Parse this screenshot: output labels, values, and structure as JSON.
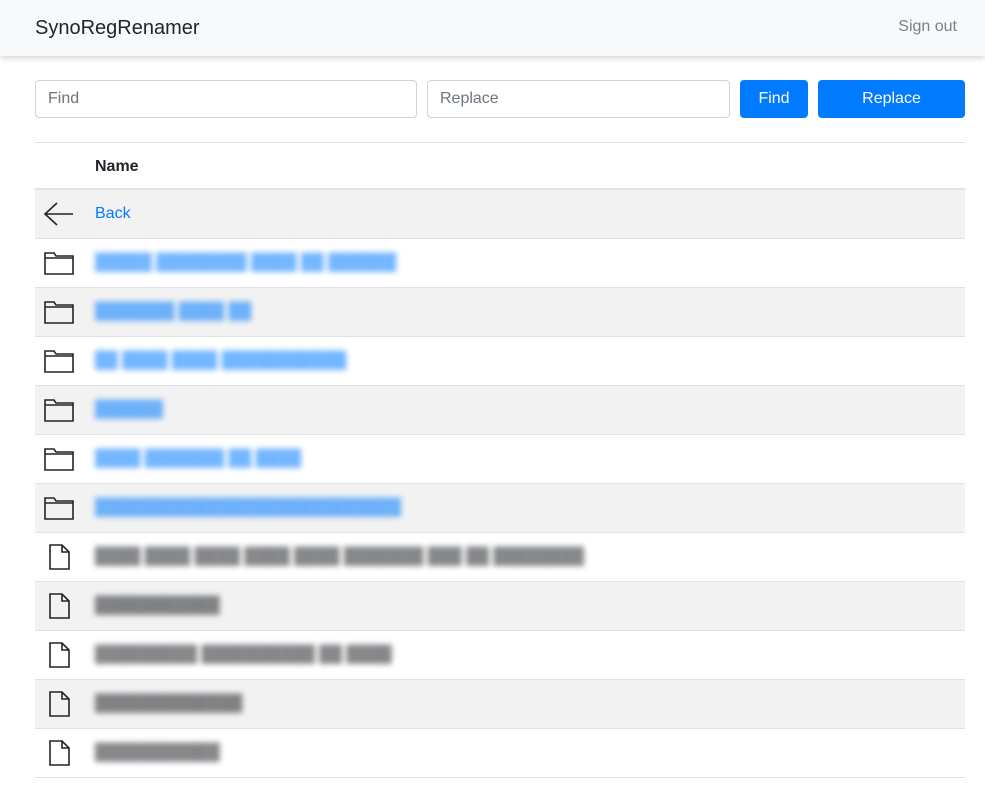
{
  "navbar": {
    "brand": "SynoRegRenamer",
    "signout": "Sign out"
  },
  "toolbar": {
    "find_placeholder": "Find",
    "replace_placeholder": "Replace",
    "find_button": "Find",
    "replace_button": "Replace"
  },
  "table": {
    "header_name": "Name",
    "back_label": "Back",
    "rows": [
      {
        "type": "folder",
        "name": "█████ ████████ ████ ██ ██████"
      },
      {
        "type": "folder",
        "name": "███████ ████ ██"
      },
      {
        "type": "folder",
        "name": "██ ████ ████ ███████████"
      },
      {
        "type": "folder",
        "name": "██████"
      },
      {
        "type": "folder",
        "name": "████ ███████ ██ ████"
      },
      {
        "type": "folder",
        "name": "███████████████████████████"
      },
      {
        "type": "file",
        "name": "████ ████ ████ ████ ████ ███████ ███ ██ ████████"
      },
      {
        "type": "file",
        "name": "███████████"
      },
      {
        "type": "file",
        "name": "█████████ ██████████ ██ ████"
      },
      {
        "type": "file",
        "name": "█████████████"
      },
      {
        "type": "file",
        "name": "███████████"
      }
    ]
  },
  "colors": {
    "accent": "#007bff",
    "navbar_bg": "#f8f9fa",
    "stripe": "#f2f2f2"
  },
  "icons": {
    "back": "arrow-left-icon",
    "folder": "folder-icon",
    "file": "file-icon"
  }
}
